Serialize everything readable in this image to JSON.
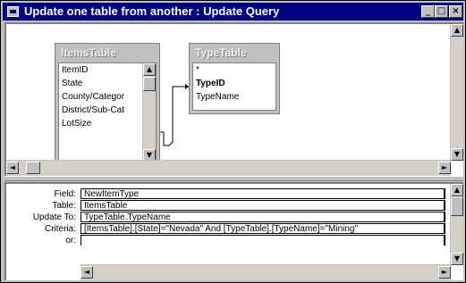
{
  "window": {
    "title": "Update one table from another : Update Query",
    "minimize_glyph": "_",
    "maximize_glyph": "□",
    "close_glyph": "×"
  },
  "tables": [
    {
      "name": "ItemsTable",
      "fields": [
        "ItemID",
        "State",
        "County/Categor",
        "District/Sub-Cat",
        "LotSize"
      ]
    },
    {
      "name": "TypeTable",
      "fields": [
        "*",
        "TypeID",
        "TypeName"
      ],
      "bold_field": "TypeID"
    }
  ],
  "relationship": {
    "from": "ItemsTable.District/Sub-Cat",
    "to": "TypeTable.TypeID"
  },
  "grid": {
    "labels": {
      "field": "Field:",
      "table": "Table:",
      "update_to": "Update To:",
      "criteria": "Criteria:",
      "or": "or:"
    },
    "values": {
      "field": "NewItemType",
      "table": "ItemsTable",
      "update_to": "TypeTable.TypeName",
      "criteria": "[ItemsTable].[State]=\"Nevada\" And [TypeTable].[TypeName]=\"Mining\"",
      "or": ""
    }
  },
  "scroll_glyphs": {
    "up": "▲",
    "down": "▼",
    "left": "◄",
    "right": "►"
  },
  "colors": {
    "titlebar": "#000080",
    "chrome": "#c0c0c0"
  }
}
